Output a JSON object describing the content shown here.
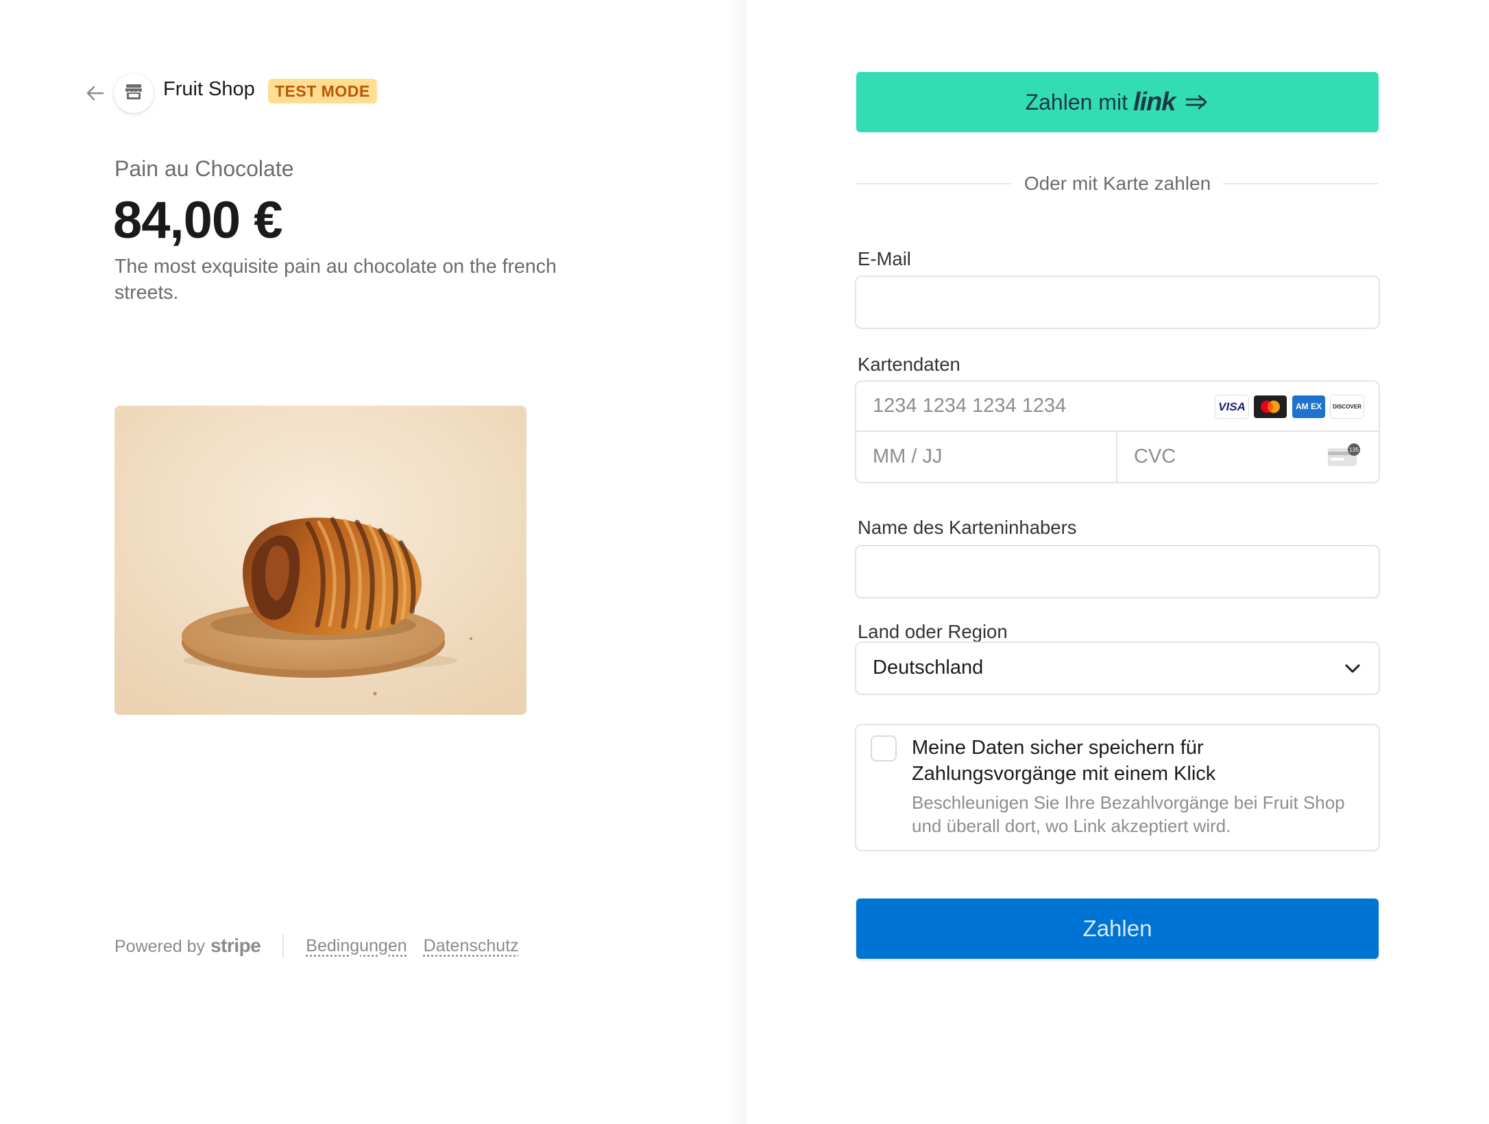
{
  "header": {
    "shop_name": "Fruit Shop",
    "badge": "TEST MODE",
    "badge_bg": "#ffde92",
    "badge_color": "#bb5504",
    "back_icon": "arrow-left-icon",
    "shop_icon": "store-icon"
  },
  "product": {
    "name": "Pain au Chocolate",
    "price": "84,00 €",
    "description": "The most exquisite pain au chocolate on the french streets.",
    "image": "pain-au-chocolat-on-cork-coaster"
  },
  "footer": {
    "powered_by": "Powered by",
    "brand": "stripe",
    "links": [
      "Bedingungen",
      "Datenschutz"
    ]
  },
  "payment": {
    "link_button": {
      "label": "Zahlen mit",
      "brand": "link",
      "color": "#33ddb3"
    },
    "or_text": "Oder mit Karte zahlen",
    "email": {
      "label": "E-Mail",
      "value": "",
      "placeholder": ""
    },
    "card": {
      "label": "Kartendaten",
      "number_placeholder": "1234 1234 1234 1234",
      "expiry_placeholder": "MM / JJ",
      "cvc_placeholder": "CVC",
      "brands": [
        "VISA",
        "Mastercard",
        "AMEX",
        "DISCOVER"
      ],
      "amex_label": "AM EX",
      "discover_label": "DISCOVER",
      "cvc_hint": "135"
    },
    "cardholder": {
      "label": "Name des Karteninhabers",
      "value": "",
      "placeholder": ""
    },
    "country": {
      "label": "Land oder Region",
      "selected": "Deutschland"
    },
    "save": {
      "checked": false,
      "title": "Meine Daten sicher speichern für Zahlungsvorgänge mit einem Klick",
      "subtitle": "Beschleunigen Sie Ihre Bezahlvorgänge bei Fruit Shop und überall dort, wo Link akzeptiert wird."
    },
    "pay_button": {
      "label": "Zahlen",
      "color": "#0074d4"
    }
  }
}
